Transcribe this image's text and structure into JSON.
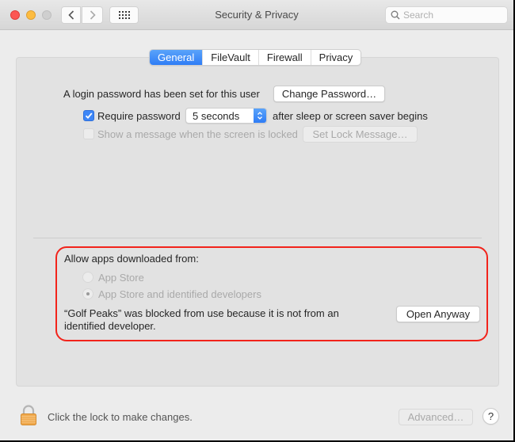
{
  "window": {
    "title": "Security & Privacy",
    "search_placeholder": "Search",
    "traffic_lights": {
      "close": "#fc5753",
      "minimize": "#fdbc40",
      "maximize": "#cfcfcf"
    }
  },
  "toolbar": {
    "back_icon": "chevron-left-icon",
    "forward_icon": "chevron-right-icon",
    "show_all_icon": "grid-icon"
  },
  "tabs": [
    {
      "label": "General",
      "active": true
    },
    {
      "label": "FileVault",
      "active": false
    },
    {
      "label": "Firewall",
      "active": false
    },
    {
      "label": "Privacy",
      "active": false
    }
  ],
  "general": {
    "login_password_text": "A login password has been set for this user",
    "change_password_button": "Change Password…",
    "require_password": {
      "label": "Require password",
      "checked": true
    },
    "delay_select": {
      "value": "5 seconds"
    },
    "after_sleep_text": "after sleep or screen saver begins",
    "show_message": {
      "label": "Show a message when the screen is locked",
      "checked": false,
      "disabled": true
    },
    "set_lock_message_button": "Set Lock Message…"
  },
  "allow_apps": {
    "heading": "Allow apps downloaded from:",
    "options": [
      {
        "label": "App Store",
        "selected": false
      },
      {
        "label": "App Store and identified developers",
        "selected": true
      }
    ],
    "blocked_message_line1": "“Golf Peaks” was blocked from use because it is not from an",
    "blocked_message_line2": "identified developer.",
    "open_anyway_button": "Open Anyway",
    "highlight_color": "#f2231b"
  },
  "footer": {
    "lock_text": "Click the lock to make changes.",
    "advanced_button": "Advanced…",
    "help_label": "?"
  },
  "accent_color": "#3d86f7"
}
